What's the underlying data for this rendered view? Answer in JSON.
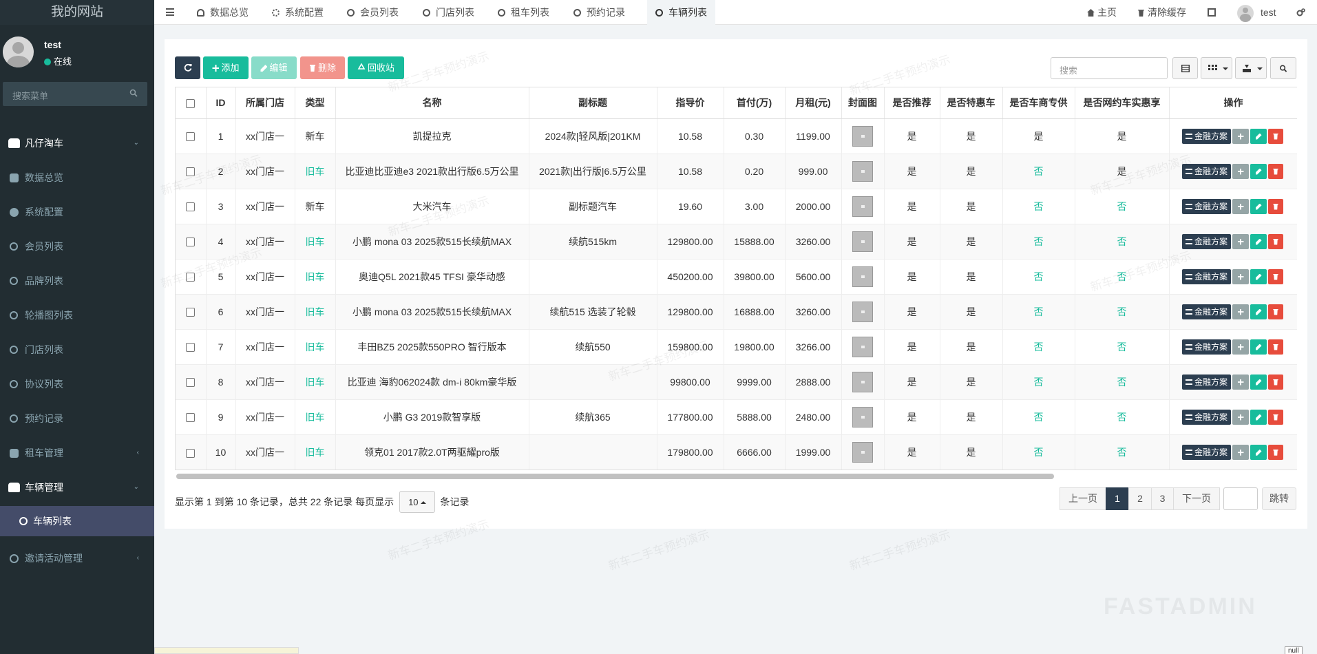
{
  "sidebar": {
    "logo": "我的网站",
    "user": {
      "name": "test",
      "status": "在线"
    },
    "search_placeholder": "搜索菜单",
    "menu": [
      {
        "label": "凡仔淘车",
        "icon": "car-icon",
        "parent": true,
        "chevron": "⌄"
      },
      {
        "label": "数据总览",
        "icon": "dashboard-icon"
      },
      {
        "label": "系统配置",
        "icon": "cogs-icon"
      },
      {
        "label": "会员列表",
        "icon": "circle-icon"
      },
      {
        "label": "品牌列表",
        "icon": "circle-icon"
      },
      {
        "label": "轮播图列表",
        "icon": "circle-icon"
      },
      {
        "label": "门店列表",
        "icon": "circle-icon"
      },
      {
        "label": "协议列表",
        "icon": "circle-icon"
      },
      {
        "label": "预约记录",
        "icon": "circle-icon"
      },
      {
        "label": "租车管理",
        "icon": "hdd-icon",
        "chevron": "‹"
      },
      {
        "label": "车辆管理",
        "icon": "car-icon",
        "parent": true,
        "chevron": "⌄"
      },
      {
        "label": "车辆列表",
        "icon": "circle-icon",
        "active": true
      },
      {
        "label": "邀请活动管理",
        "icon": "search-icon",
        "chevron": "‹"
      }
    ]
  },
  "topbar": {
    "tabs": [
      {
        "label": "数据总览",
        "icon": "dashboard-icon"
      },
      {
        "label": "系统配置",
        "icon": "cogs-icon"
      },
      {
        "label": "会员列表",
        "icon": "circle-icon"
      },
      {
        "label": "门店列表",
        "icon": "circle-icon"
      },
      {
        "label": "租车列表",
        "icon": "circle-icon"
      },
      {
        "label": "预约记录",
        "icon": "circle-icon"
      },
      {
        "label": "车辆列表",
        "icon": "circle-icon",
        "active": true
      }
    ],
    "home_label": "主页",
    "clear_cache_label": "清除缓存",
    "user_name": "test"
  },
  "toolbar": {
    "add_label": "添加",
    "edit_label": "编辑",
    "delete_label": "删除",
    "recycle_label": "回收站",
    "search_placeholder": "搜索"
  },
  "table": {
    "columns": [
      "ID",
      "所属门店",
      "类型",
      "名称",
      "副标题",
      "指导价",
      "首付(万)",
      "月租(元)",
      "封面图",
      "是否推荐",
      "是否特惠车",
      "是否车商专供",
      "是否网约车实惠享",
      "操作"
    ],
    "finance_label": "金融方案",
    "rows": [
      {
        "id": "1",
        "store": "xx门店一",
        "type": "新车",
        "name": "凯提拉克",
        "subtitle": "2024款|轻风版|201KM",
        "price": "10.58",
        "down": "0.30",
        "monthly": "1199.00",
        "recommend": "是",
        "special": "是",
        "dealer": "是",
        "ride": "是"
      },
      {
        "id": "2",
        "store": "xx门店一",
        "type": "旧车",
        "name": "比亚迪比亚迪e3 2021款出行版6.5万公里",
        "subtitle": "2021款|出行版|6.5万公里",
        "price": "10.58",
        "down": "0.20",
        "monthly": "999.00",
        "recommend": "是",
        "special": "是",
        "dealer": "否",
        "ride": "是"
      },
      {
        "id": "3",
        "store": "xx门店一",
        "type": "新车",
        "name": "大米汽车",
        "subtitle": "副标题汽车",
        "price": "19.60",
        "down": "3.00",
        "monthly": "2000.00",
        "recommend": "是",
        "special": "是",
        "dealer": "否",
        "ride": "否"
      },
      {
        "id": "4",
        "store": "xx门店一",
        "type": "旧车",
        "name": "小鹏 mona 03 2025款515长续航MAX",
        "subtitle": "续航515km",
        "price": "129800.00",
        "down": "15888.00",
        "monthly": "3260.00",
        "recommend": "是",
        "special": "是",
        "dealer": "否",
        "ride": "否"
      },
      {
        "id": "5",
        "store": "xx门店一",
        "type": "旧车",
        "name": "奥迪Q5L 2021款45 TFSI 豪华动感",
        "subtitle": "",
        "price": "450200.00",
        "down": "39800.00",
        "monthly": "5600.00",
        "recommend": "是",
        "special": "是",
        "dealer": "否",
        "ride": "否"
      },
      {
        "id": "6",
        "store": "xx门店一",
        "type": "旧车",
        "name": "小鹏 mona 03 2025款515长续航MAX",
        "subtitle": "续航515 选装了轮毂",
        "price": "129800.00",
        "down": "16888.00",
        "monthly": "3260.00",
        "recommend": "是",
        "special": "是",
        "dealer": "否",
        "ride": "否"
      },
      {
        "id": "7",
        "store": "xx门店一",
        "type": "旧车",
        "name": "丰田BZ5 2025款550PRO 智行版本",
        "subtitle": "续航550",
        "price": "159800.00",
        "down": "19800.00",
        "monthly": "3266.00",
        "recommend": "是",
        "special": "是",
        "dealer": "否",
        "ride": "否"
      },
      {
        "id": "8",
        "store": "xx门店一",
        "type": "旧车",
        "name": "比亚迪 海豹062024款 dm-i 80km豪华版",
        "subtitle": "",
        "price": "99800.00",
        "down": "9999.00",
        "monthly": "2888.00",
        "recommend": "是",
        "special": "是",
        "dealer": "否",
        "ride": "否"
      },
      {
        "id": "9",
        "store": "xx门店一",
        "type": "旧车",
        "name": "小鹏 G3 2019款智享版",
        "subtitle": "续航365",
        "price": "177800.00",
        "down": "5888.00",
        "monthly": "2480.00",
        "recommend": "是",
        "special": "是",
        "dealer": "否",
        "ride": "否"
      },
      {
        "id": "10",
        "store": "xx门店一",
        "type": "旧车",
        "name": "领克01 2017款2.0T两驱耀pro版",
        "subtitle": "",
        "price": "179800.00",
        "down": "6666.00",
        "monthly": "1999.00",
        "recommend": "是",
        "special": "是",
        "dealer": "否",
        "ride": "否"
      }
    ]
  },
  "pagination": {
    "info": "显示第 1 到第 10 条记录，总共 22 条记录 每页显示",
    "page_size": "10",
    "suffix": "条记录",
    "prev": "上一页",
    "pages": [
      "1",
      "2",
      "3"
    ],
    "next": "下一页",
    "jump": "跳转"
  },
  "watermark_text": "新车二手车预约演示",
  "brand_watermark": "FASTADMIN",
  "null_tag": "null",
  "colors": {
    "primary": "#2c3e50",
    "success": "#18bc9c",
    "danger": "#e74c3c",
    "sidebar": "#222d32",
    "active_menu": "#444c69"
  }
}
